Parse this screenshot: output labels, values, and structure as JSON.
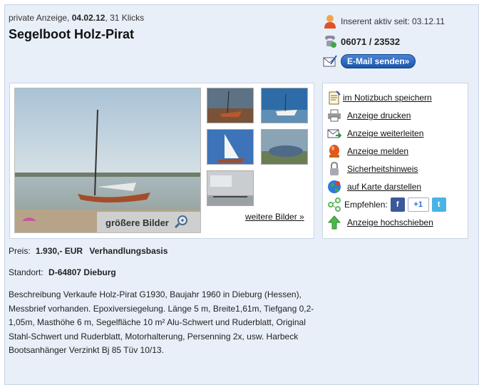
{
  "listing": {
    "type_label": "private Anzeige,",
    "date": "04.02.12",
    "clicks": "31 Klicks",
    "title": "Segelboot Holz-Pirat"
  },
  "seller": {
    "active_since": "Inserent aktiv seit: 03.12.11",
    "phone": "06071 / 23532",
    "email_button": "E-Mail senden»"
  },
  "gallery": {
    "bigger_images": "größere Bilder",
    "more_images": "weitere Bilder »"
  },
  "actions": {
    "items": [
      {
        "label": "im Notizbuch speichern",
        "icon": "notepad-icon"
      },
      {
        "label": "Anzeige drucken",
        "icon": "printer-icon"
      },
      {
        "label": "Anzeige weiterleiten",
        "icon": "forward-mail-icon"
      },
      {
        "label": "Anzeige melden",
        "icon": "alert-light-icon"
      },
      {
        "label": "Sicherheitshinweis",
        "icon": "lock-icon"
      },
      {
        "label": "auf Karte darstellen",
        "icon": "globe-icon"
      },
      {
        "label": "Empfehlen:",
        "icon": "share-icon"
      },
      {
        "label": "Anzeige hochschieben",
        "icon": "up-arrow-icon"
      }
    ],
    "share": {
      "facebook": "f",
      "plusone": "+1",
      "twitter": "t"
    }
  },
  "price": {
    "label": "Preis:",
    "value": "1.930,- EUR",
    "note": "Verhandlungsbasis"
  },
  "location": {
    "label": "Standort:",
    "value": "D-64807 Dieburg"
  },
  "description": "Beschreibung Verkaufe Holz-Pirat G1930, Baujahr 1960 in Dieburg (Hessen), Messbrief vorhanden. Epoxiversiegelung. Länge 5 m, Breite1,61m, Tiefgang 0,2-1,05m, Masthöhe 6 m, Segelfläche 10 m² Alu-Schwert und Ruderblatt, Original Stahl-Schwert und Ruderblatt, Motorhalterung, Persenning 2x, usw. Harbeck Bootsanhänger Verzinkt Bj 85 Tüv 10/13.",
  "colors": {
    "panel_bg": "#e8eff8",
    "email_button": "#1c56a8"
  }
}
